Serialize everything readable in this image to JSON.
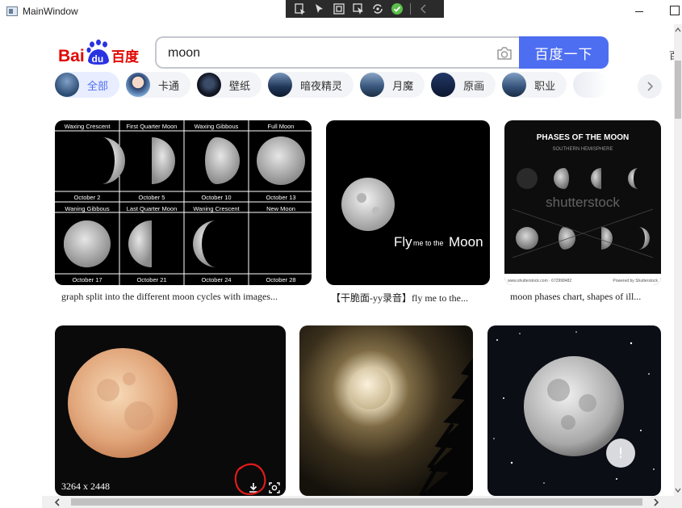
{
  "window": {
    "title": "MainWindow"
  },
  "search": {
    "query": "moon",
    "button_label": "百度一下"
  },
  "logo": {
    "text_bai": "Bai",
    "text_du": "du",
    "text_cn": "百度"
  },
  "edge_glyph": "百",
  "tags": [
    {
      "label": "全部",
      "active": true
    },
    {
      "label": "卡通"
    },
    {
      "label": "壁纸"
    },
    {
      "label": "暗夜精灵"
    },
    {
      "label": "月魔"
    },
    {
      "label": "原画"
    },
    {
      "label": "职业"
    }
  ],
  "results": [
    {
      "caption": "graph split into the different moon cycles with images...",
      "phases_top": [
        "Waxing Crescent",
        "First Quarter Moon",
        "Waxing Gibbous",
        "Full Moon"
      ],
      "dates_top": [
        "October 2",
        "October 5",
        "October 10",
        "October 13"
      ],
      "phases_bottom": [
        "Waning Gibbous",
        "Last Quarter Moon",
        "Waning Crescent",
        "New Moon"
      ],
      "dates_bottom": [
        "October 17",
        "October 21",
        "October 24",
        "October 28"
      ]
    },
    {
      "caption": "【干脆面-yy录音】fly me to the...",
      "overlay_fly": "Fly",
      "overlay_mid": "me to the",
      "overlay_moon": "Moon"
    },
    {
      "caption": "moon phases chart, shapes of ill...",
      "chart_title": "PHASES OF THE MOON",
      "chart_subtitle": "SOUTHERN HEMISPHERE",
      "watermark": "shutterstock",
      "footer_left": "www.shutterstock.com · 672998482",
      "footer_right": "Powered by Shutterstock"
    },
    {
      "size_label": "3264 x 2448"
    },
    {},
    {}
  ],
  "feedback_glyph": "!",
  "colors": {
    "accent": "#4e6ef2",
    "annotation": "#e11a1a"
  }
}
